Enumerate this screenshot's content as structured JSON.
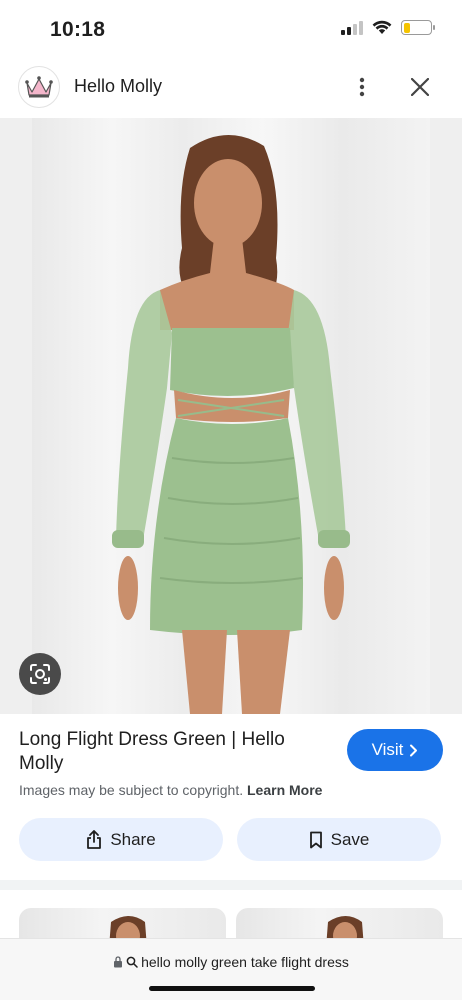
{
  "status_bar": {
    "time": "10:18",
    "battery_level": 0.25,
    "signal_bars": 2,
    "icons": [
      "signal-icon",
      "wifi-icon",
      "battery-icon"
    ]
  },
  "header": {
    "site_name": "Hello Molly",
    "logo_icon": "crown-logo-icon",
    "more_icon": "more-vert-icon",
    "close_icon": "close-icon"
  },
  "image": {
    "alt": "Model wearing green long-sleeve ruched cut-out mini dress",
    "lens_icon": "google-lens-icon"
  },
  "product": {
    "title": "Long Flight Dress Green | Hello Molly",
    "visit_label": "Visit",
    "copyright_text": "Images may be subject to copyright.",
    "learn_more": "Learn More"
  },
  "actions": {
    "share_label": "Share",
    "save_label": "Save"
  },
  "url_bar": {
    "query": "hello molly green take flight dress"
  },
  "colors": {
    "accent": "#1a73e8",
    "action_bg": "#e8f0fe",
    "dress": "#9cc08f",
    "battery": "#f5c400"
  }
}
